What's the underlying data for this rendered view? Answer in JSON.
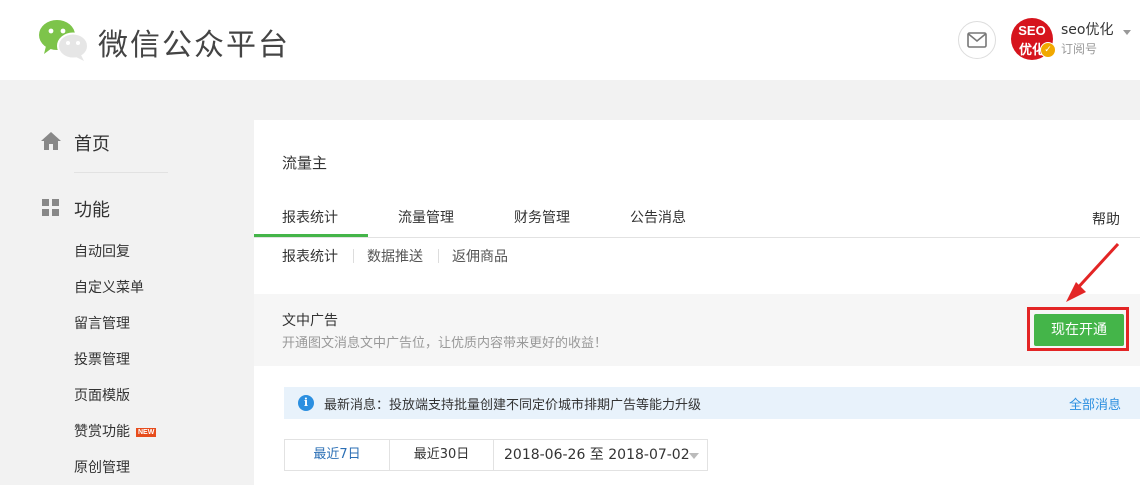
{
  "header": {
    "platform_name": "微信公众平台",
    "avatar_line1": "SEO",
    "avatar_line2": "优化",
    "account_name": "seo优化",
    "account_type": "订阅号"
  },
  "sidebar": {
    "home_label": "首页",
    "function_label": "功能",
    "items": [
      {
        "label": "自动回复"
      },
      {
        "label": "自定义菜单"
      },
      {
        "label": "留言管理"
      },
      {
        "label": "投票管理"
      },
      {
        "label": "页面模版"
      },
      {
        "label": "赞赏功能",
        "badge": "NEW"
      },
      {
        "label": "原创管理"
      }
    ]
  },
  "main": {
    "title": "流量主",
    "tabs": [
      {
        "label": "报表统计",
        "active": true
      },
      {
        "label": "流量管理"
      },
      {
        "label": "财务管理"
      },
      {
        "label": "公告消息"
      }
    ],
    "help_label": "帮助",
    "subtabs": [
      {
        "label": "报表统计",
        "active": true
      },
      {
        "label": "数据推送"
      },
      {
        "label": "返佣商品"
      }
    ],
    "promo": {
      "title": "文中广告",
      "description": "开通图文消息文中广告位，让优质内容带来更好的收益！",
      "button_label": "现在开通"
    },
    "notice": {
      "text": "最新消息：投放端支持批量创建不同定价城市排期广告等能力升级",
      "link": "全部消息"
    },
    "date_filter": {
      "options": [
        {
          "label": "最近7日",
          "selected": true
        },
        {
          "label": "最近30日"
        }
      ],
      "range": "2018-06-26 至 2018-07-02"
    }
  },
  "colors": {
    "brand_green": "#44b549",
    "highlight_red": "#e32525",
    "info_blue": "#2b8fe0"
  }
}
